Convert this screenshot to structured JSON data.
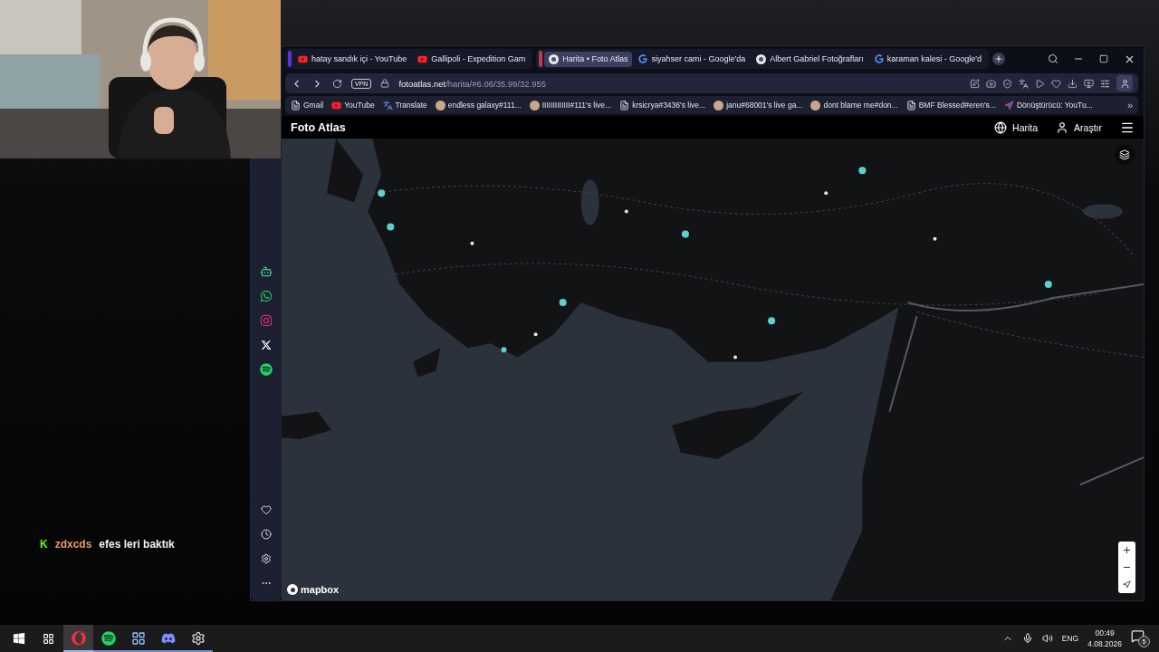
{
  "chat": {
    "badge": "K",
    "user": "zdxcds",
    "message": "efes leri baktık"
  },
  "browser": {
    "tab_groups": [
      {
        "color": "#5533dd",
        "tabs": [
          {
            "title": "hatay sandık içi - YouTube",
            "kind": "video",
            "selected": false
          },
          {
            "title": "Gallipoli - Expedition Gam",
            "kind": "video",
            "selected": false
          }
        ]
      },
      {
        "color": "#c23a4e",
        "tabs": [
          {
            "title": "Harita • Foto Atlas",
            "kind": "site",
            "selected": true
          },
          {
            "title": "siyahser cami - Google'da",
            "kind": "search",
            "selected": false
          },
          {
            "title": "Albert Gabriel Fotoğrafları",
            "kind": "site",
            "selected": false
          },
          {
            "title": "karaman kalesi - Google'd",
            "kind": "search",
            "selected": false
          }
        ]
      }
    ],
    "address": {
      "vpn": "VPN",
      "host": "fotoatlas.net",
      "path": "/harita/#6.06/35.99/32.955"
    },
    "bookmarks": [
      {
        "label": "Gmail",
        "kind": "page"
      },
      {
        "label": "YouTube",
        "kind": "video"
      },
      {
        "label": "Translate",
        "kind": "translate"
      },
      {
        "label": "endless galaxy#111...",
        "kind": "avatar"
      },
      {
        "label": "IIIIIIIIIIIII#111's live...",
        "kind": "avatar"
      },
      {
        "label": "krsicrya#3436's live...",
        "kind": "page"
      },
      {
        "label": "janu#68001's live ga...",
        "kind": "avatar"
      },
      {
        "label": "dont blame me#don...",
        "kind": "avatar"
      },
      {
        "label": "BMF Blessed#eren's...",
        "kind": "page"
      },
      {
        "label": "Dönüştürücü: YouTu...",
        "kind": "converter"
      }
    ],
    "bookmarks_more": "»"
  },
  "site": {
    "brand": "Foto Atlas",
    "nav": [
      {
        "label": "Harita",
        "kind": "globe"
      },
      {
        "label": "Araştır",
        "kind": "explore"
      }
    ]
  },
  "map": {
    "kind": "picture",
    "attribution": "mapbox"
  },
  "taskbar": {
    "apps": [
      {
        "kind": "browser",
        "active": true
      },
      {
        "kind": "music",
        "active": false
      },
      {
        "kind": "tool",
        "active": false
      },
      {
        "kind": "chat",
        "active": false
      },
      {
        "kind": "recorder",
        "active": false
      }
    ],
    "language": "ENG",
    "time": "00:49",
    "date": "4.08.2026",
    "notifications": "5"
  }
}
